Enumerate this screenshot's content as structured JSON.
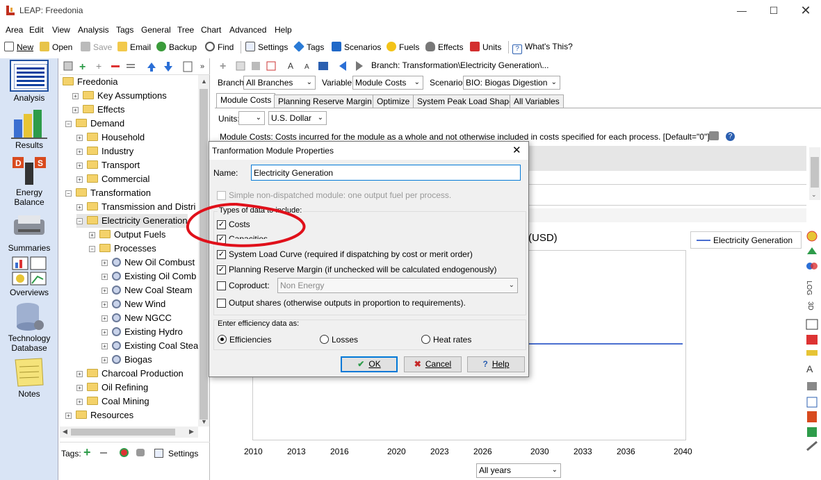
{
  "window": {
    "title": "LEAP: Freedonia"
  },
  "menu": [
    "Area",
    "Edit",
    "View",
    "Analysis",
    "Tags",
    "General",
    "Tree",
    "Chart",
    "Advanced",
    "Help"
  ],
  "toolbar": {
    "new": "New",
    "open": "Open",
    "save": "Save",
    "email": "Email",
    "backup": "Backup",
    "find": "Find",
    "settings": "Settings",
    "tags": "Tags",
    "scenarios": "Scenarios",
    "fuels": "Fuels",
    "effects": "Effects",
    "units": "Units",
    "whats_this": "What's This?"
  },
  "leftbar": {
    "items": [
      {
        "label": "Analysis"
      },
      {
        "label": "Results"
      },
      {
        "label": "Energy Balance"
      },
      {
        "label": "Summaries"
      },
      {
        "label": "Overviews"
      },
      {
        "label": "Technology Database"
      },
      {
        "label": "Notes"
      }
    ]
  },
  "tree": {
    "root": "Freedonia",
    "items": [
      {
        "label": "Key Assumptions"
      },
      {
        "label": "Effects"
      },
      {
        "label": "Demand"
      },
      {
        "label": "Household"
      },
      {
        "label": "Industry"
      },
      {
        "label": "Transport"
      },
      {
        "label": "Commercial"
      },
      {
        "label": "Transformation"
      },
      {
        "label": "Transmission and Distri"
      },
      {
        "label": "Electricity Generation"
      },
      {
        "label": "Output Fuels"
      },
      {
        "label": "Processes"
      },
      {
        "label": "New Oil Combust"
      },
      {
        "label": "Existing Oil Comb"
      },
      {
        "label": "New Coal Steam"
      },
      {
        "label": "New Wind"
      },
      {
        "label": "New NGCC"
      },
      {
        "label": "Existing Hydro"
      },
      {
        "label": "Existing Coal Stea"
      },
      {
        "label": "Biogas"
      },
      {
        "label": "Charcoal Production"
      },
      {
        "label": "Oil Refining"
      },
      {
        "label": "Coal Mining"
      },
      {
        "label": "Resources"
      }
    ],
    "tags_label": "Tags:",
    "settings_label": "Settings"
  },
  "main": {
    "breadcrumb": "Branch: Transformation\\Electricity Generation\\...",
    "branch_label": "Branch:",
    "branch_value": "All Branches",
    "variable_label": "Variable:",
    "variable_value": "Module Costs",
    "scenario_label": "Scenario:",
    "scenario_value": "BIO: Biogas Digestion",
    "tabs": [
      "Module Costs",
      "Planning Reserve Margin",
      "Optimize",
      "System Peak Load Shape",
      "All Variables"
    ],
    "units_label": "Units:",
    "units_value": "U.S. Dollar",
    "description": "Module Costs: Costs incurred for the module as a whole and not otherwise included in costs specified for each process. [Default=\"0\"]",
    "chart_unit": "(USD)",
    "legend": "Electricity Generation",
    "x_ticks": [
      "2010",
      "2013",
      "2016",
      "2020",
      "2023",
      "2026",
      "2030",
      "2033",
      "2036",
      "2040"
    ],
    "years_select": "All years"
  },
  "dialog": {
    "title": "Tranformation Module Properties",
    "name_label": "Name:",
    "name_value": "Electricity Generation",
    "simple_label": "Simple non-dispatched module: one output fuel per process.",
    "types_label": "Types of data to include:",
    "costs_label": "Costs",
    "capacities_label": "Capacities",
    "load_curve_label": "System Load Curve (required if dispatching by cost or merit order)",
    "reserve_label": "Planning Reserve Margin (if unchecked will be calculated endogenously)",
    "coproduct_label": "Coproduct:",
    "coproduct_value": "Non Energy",
    "output_shares_label": "Output shares (otherwise outputs in proportion to requirements).",
    "efficiency_label": "Enter efficiency data as:",
    "eff_options": [
      "Efficiencies",
      "Losses",
      "Heat rates"
    ],
    "ok": "OK",
    "cancel": "Cancel",
    "help": "Help"
  },
  "colors": {
    "annotation": "#e0101a",
    "accent": "#0078d7",
    "leftbar": "#d9e4f5"
  }
}
